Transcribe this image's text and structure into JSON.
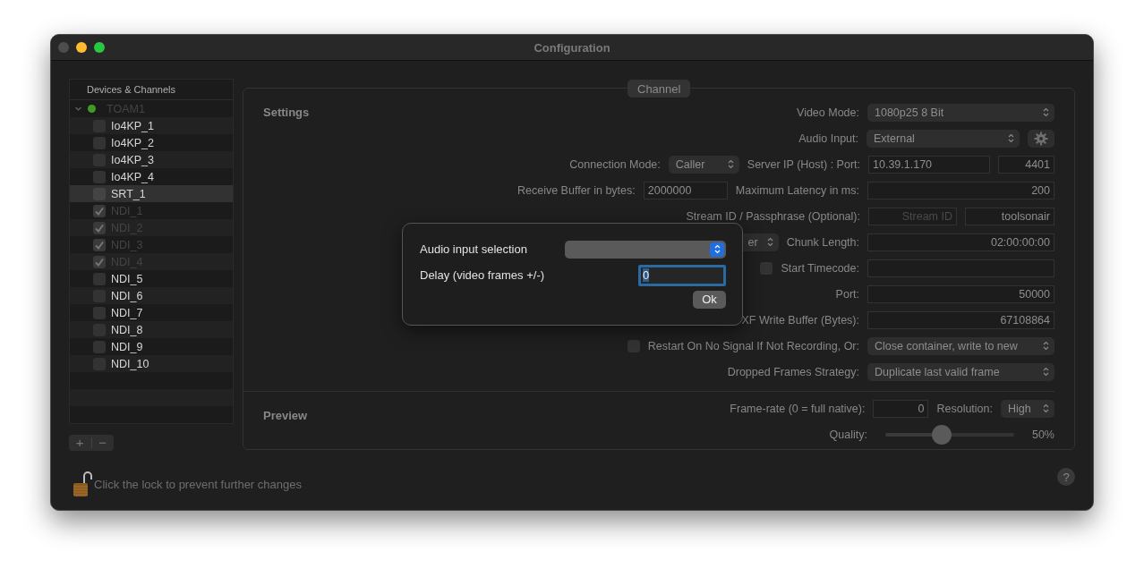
{
  "window": {
    "title": "Configuration"
  },
  "sidebar": {
    "header": "Devices & Channels",
    "root": {
      "label": "TOAM1",
      "expanded": true,
      "color": "#3f9a26",
      "disabled": true,
      "children": [
        {
          "label": "Io4KP_1",
          "checked": false,
          "disabled": false,
          "selected": false
        },
        {
          "label": "Io4KP_2",
          "checked": false,
          "disabled": false,
          "selected": false
        },
        {
          "label": "Io4KP_3",
          "checked": false,
          "disabled": false,
          "selected": false
        },
        {
          "label": "Io4KP_4",
          "checked": false,
          "disabled": false,
          "selected": false
        },
        {
          "label": "SRT_1",
          "checked": false,
          "disabled": false,
          "selected": true
        },
        {
          "label": "NDI_1",
          "checked": true,
          "disabled": true,
          "selected": false
        },
        {
          "label": "NDI_2",
          "checked": true,
          "disabled": true,
          "selected": false
        },
        {
          "label": "NDI_3",
          "checked": true,
          "disabled": true,
          "selected": false
        },
        {
          "label": "NDI_4",
          "checked": true,
          "disabled": true,
          "selected": false
        },
        {
          "label": "NDI_5",
          "checked": false,
          "disabled": false,
          "selected": false
        },
        {
          "label": "NDI_6",
          "checked": false,
          "disabled": false,
          "selected": false
        },
        {
          "label": "NDI_7",
          "checked": false,
          "disabled": false,
          "selected": false
        },
        {
          "label": "NDI_8",
          "checked": false,
          "disabled": false,
          "selected": false
        },
        {
          "label": "NDI_9",
          "checked": false,
          "disabled": false,
          "selected": false
        },
        {
          "label": "NDI_10",
          "checked": false,
          "disabled": false,
          "selected": false
        }
      ]
    },
    "add_button": "+",
    "remove_button": "−"
  },
  "tab": {
    "label": "Channel"
  },
  "settings": {
    "title": "Settings",
    "rows": [
      {
        "items": [
          {
            "kind": "label",
            "text": "Video Mode:"
          },
          {
            "kind": "popup",
            "value": "1080p25 8 Bit"
          }
        ]
      },
      {
        "items": [
          {
            "kind": "label",
            "text": "Audio Input:"
          },
          {
            "kind": "popup",
            "value": "External"
          },
          {
            "kind": "gear"
          }
        ]
      },
      {
        "items": [
          {
            "kind": "label",
            "text": "Connection Mode:"
          },
          {
            "kind": "popup",
            "value": "Caller"
          },
          {
            "kind": "label",
            "text": "Server IP (Host) : Port:"
          },
          {
            "kind": "field",
            "value": "10.39.1.170"
          },
          {
            "kind": "field",
            "value": "4401"
          }
        ]
      },
      {
        "items": [
          {
            "kind": "label",
            "text": "Receive Buffer in bytes:"
          },
          {
            "kind": "field",
            "value": "2000000"
          },
          {
            "kind": "label",
            "text": "Maximum Latency in ms:"
          },
          {
            "kind": "field",
            "value": "200"
          }
        ]
      },
      {
        "items": [
          {
            "kind": "label",
            "text": "Stream ID / Passphrase (Optional):"
          },
          {
            "kind": "field",
            "placeholder": "Stream ID"
          },
          {
            "kind": "field",
            "value": "toolsonair"
          }
        ]
      },
      {
        "items": [
          {
            "kind": "popup",
            "value": "er"
          },
          {
            "kind": "label",
            "text": "Chunk Length:"
          },
          {
            "kind": "field",
            "value": "02:00:00:00"
          }
        ]
      },
      {
        "items": [
          {
            "kind": "checkbox",
            "checked": false
          },
          {
            "kind": "label",
            "text": "Start Timecode:"
          },
          {
            "kind": "field",
            "value": ""
          }
        ]
      },
      {
        "items": [
          {
            "kind": "label",
            "text": "Port:"
          },
          {
            "kind": "field",
            "value": "50000"
          }
        ]
      },
      {
        "items": [
          {
            "kind": "label",
            "text": "XF Write Buffer (Bytes):"
          },
          {
            "kind": "field",
            "value": "67108864"
          }
        ]
      },
      {
        "items": [
          {
            "kind": "checkbox",
            "checked": false
          },
          {
            "kind": "label",
            "text": "Restart On No Signal If Not Recording, Or:"
          },
          {
            "kind": "popup",
            "value": "Close container, write to new"
          }
        ]
      },
      {
        "items": [
          {
            "kind": "label",
            "text": "Dropped Frames Strategy:"
          },
          {
            "kind": "popup",
            "value": "Duplicate last valid frame"
          }
        ]
      }
    ]
  },
  "preview": {
    "title": "Preview",
    "rows": [
      {
        "items": [
          {
            "kind": "label",
            "text": "Frame-rate (0 = full native):"
          },
          {
            "kind": "field",
            "value": "0"
          },
          {
            "kind": "label",
            "text": "Resolution:"
          },
          {
            "kind": "popup",
            "value": "High"
          }
        ]
      },
      {
        "items": [
          {
            "kind": "label",
            "text": "Quality:"
          },
          {
            "kind": "slider",
            "level": 0.44
          },
          {
            "kind": "reading",
            "text": "50%"
          }
        ]
      }
    ]
  },
  "lock_text": "Click the lock to prevent further changes",
  "help_button": "?",
  "dialog": {
    "rows": [
      {
        "label": "Audio input selection",
        "kind": "popup",
        "value": ""
      },
      {
        "label": "Delay (video frames +/-)",
        "kind": "field",
        "value": "0"
      }
    ],
    "ok_button": "Ok"
  }
}
